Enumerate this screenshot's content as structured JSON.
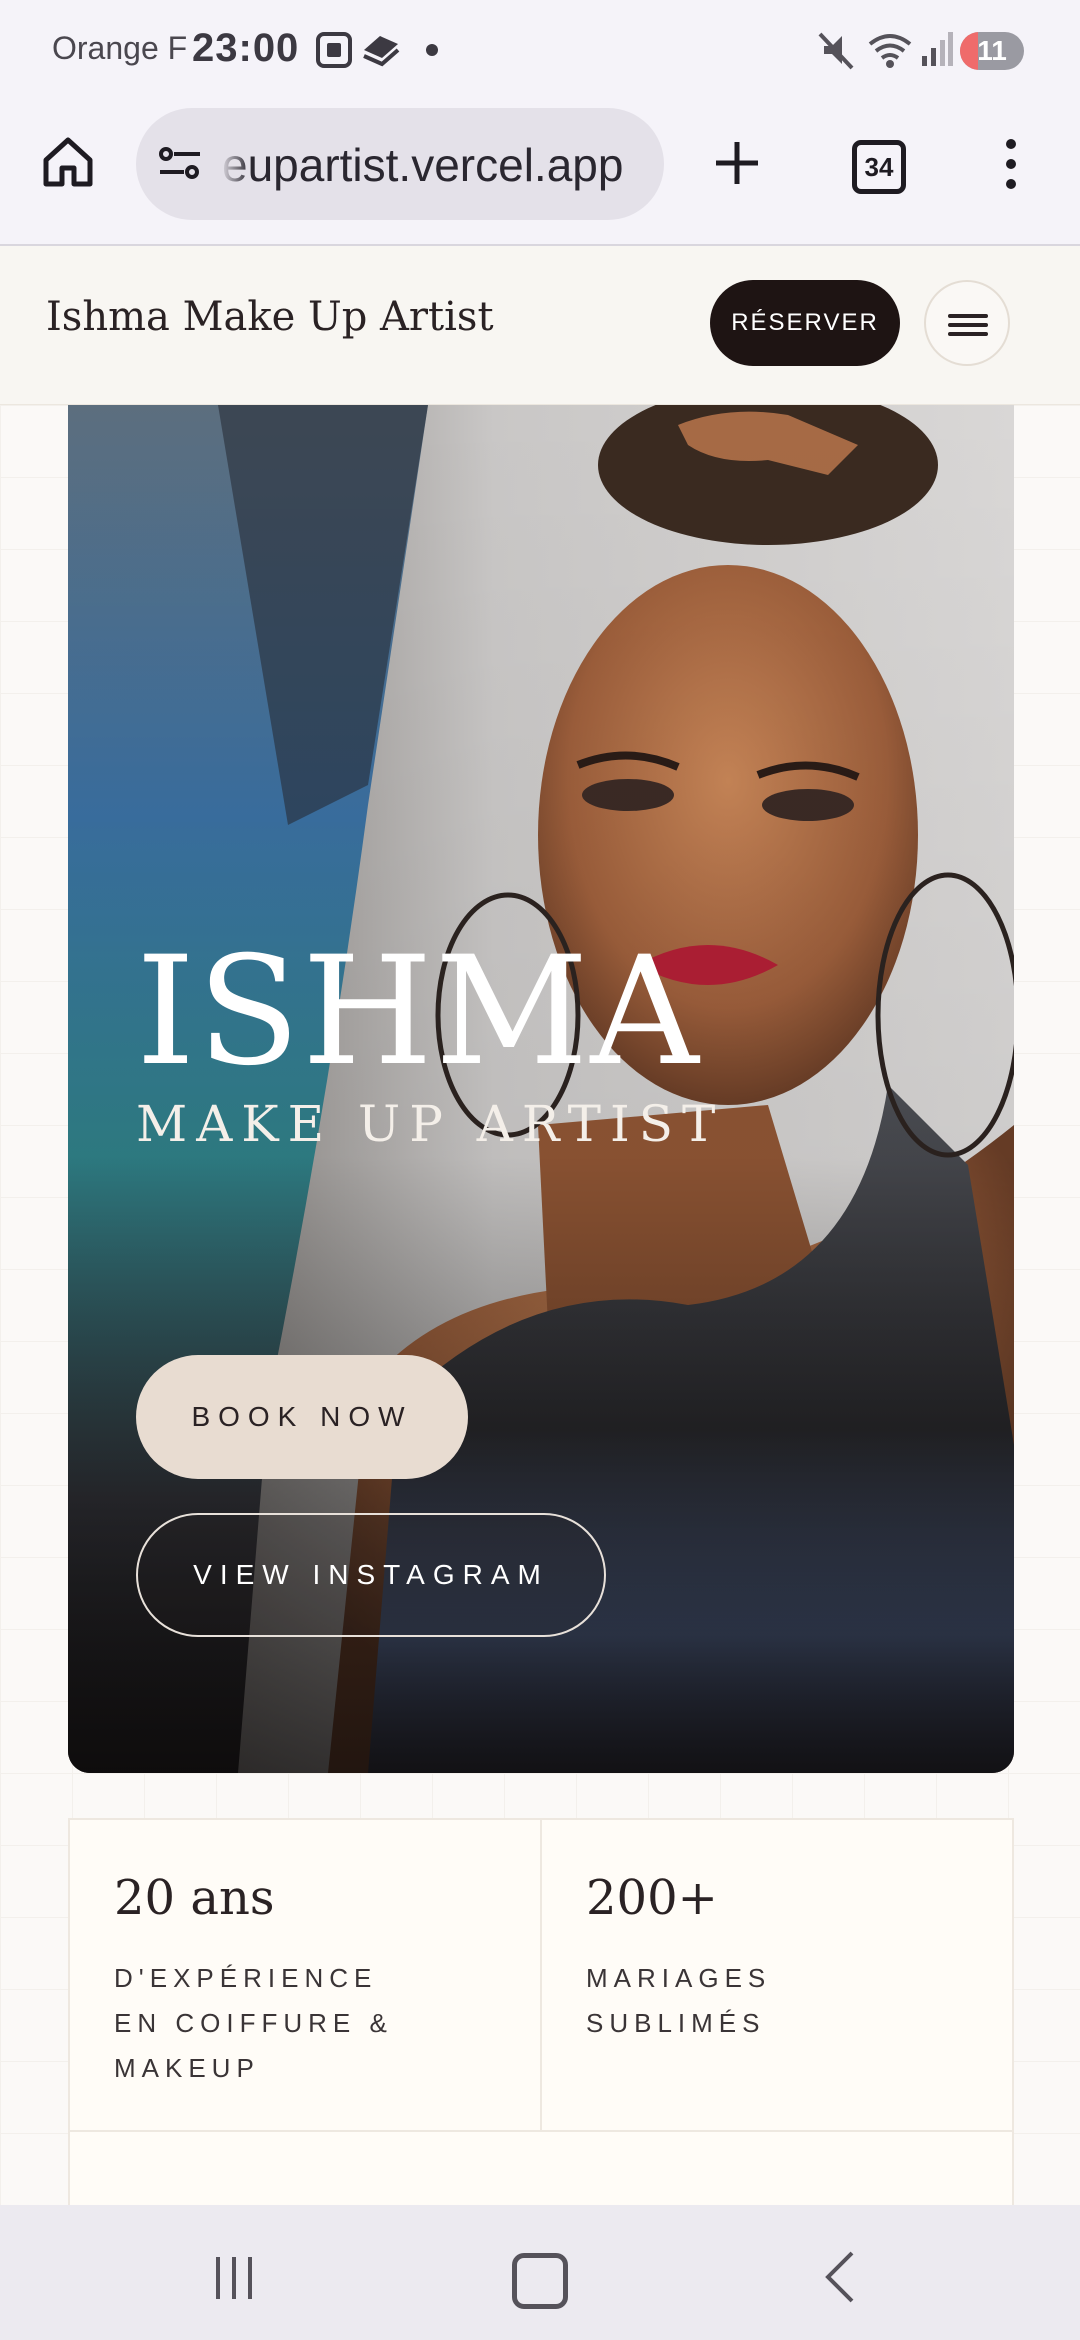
{
  "status_bar": {
    "carrier": "Orange F",
    "time": "23:00",
    "battery": "11"
  },
  "browser": {
    "url": "eupartist.vercel.app",
    "tab_count": "34"
  },
  "site": {
    "brand": "Ishma Make Up Artist",
    "reserve_label": "RÉSERVER"
  },
  "hero": {
    "title": "ISHMA",
    "subtitle": "MAKE UP ARTIST",
    "book_label": "BOOK NOW",
    "instagram_label": "VIEW INSTAGRAM"
  },
  "stats": [
    {
      "value": "20 ans",
      "label": "D'EXPÉRIENCE EN COIFFURE & MAKEUP"
    },
    {
      "value": "200+",
      "label": "MARIAGES SUBLIMÉS"
    }
  ],
  "colors": {
    "reserve_bg": "#1e1413",
    "book_bg": "#e8dcd1",
    "page_bg": "#fbf9f7"
  }
}
